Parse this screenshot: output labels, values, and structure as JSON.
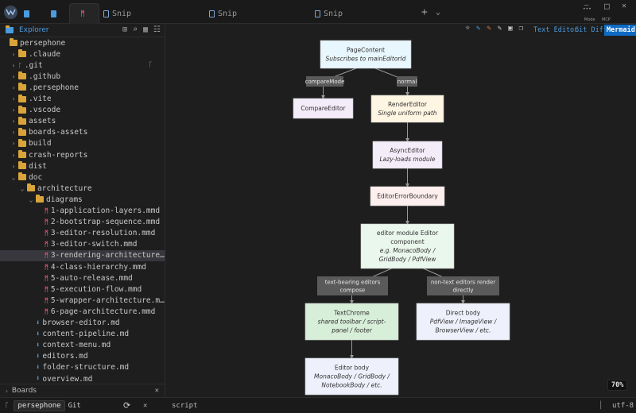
{
  "tabs": [
    {
      "label": "",
      "icon": "document-icon"
    },
    {
      "label": "",
      "icon": "document-icon"
    },
    {
      "label": "",
      "icon": "mermaid-icon"
    },
    {
      "label": "Snip",
      "icon": "document-icon"
    },
    {
      "label": "Snip",
      "icon": "document-icon"
    },
    {
      "label": "Snip",
      "icon": "document-icon"
    }
  ],
  "window": {
    "new_tab": "+",
    "dropdown": "⌄",
    "dots": "•••",
    "mode_label": "Mode",
    "mcp_label": "MCP",
    "max": "□",
    "close": "✕",
    "minimize": "—"
  },
  "sidebar": {
    "title": "Explorer",
    "git_branch": "ᚴ",
    "tree": [
      {
        "label": "persephone",
        "type": "folder",
        "depth": 0,
        "chevron": ""
      },
      {
        "label": ".claude",
        "type": "folder",
        "depth": 1,
        "chevron": "›"
      },
      {
        "label": ".git",
        "type": "git",
        "depth": 1,
        "chevron": "›"
      },
      {
        "label": ".github",
        "type": "folder",
        "depth": 1,
        "chevron": "›"
      },
      {
        "label": ".persephone",
        "type": "folder",
        "depth": 1,
        "chevron": "›"
      },
      {
        "label": ".vite",
        "type": "folder",
        "depth": 1,
        "chevron": "›"
      },
      {
        "label": ".vscode",
        "type": "folder",
        "depth": 1,
        "chevron": "›"
      },
      {
        "label": "assets",
        "type": "folder",
        "depth": 1,
        "chevron": "›"
      },
      {
        "label": "boards-assets",
        "type": "folder",
        "depth": 1,
        "chevron": "›"
      },
      {
        "label": "build",
        "type": "folder",
        "depth": 1,
        "chevron": "›"
      },
      {
        "label": "crash-reports",
        "type": "folder",
        "depth": 1,
        "chevron": "›"
      },
      {
        "label": "dist",
        "type": "folder",
        "depth": 1,
        "chevron": "›"
      },
      {
        "label": "doc",
        "type": "folder",
        "depth": 1,
        "chevron": "⌄"
      },
      {
        "label": "architecture",
        "type": "folder",
        "depth": 2,
        "chevron": "⌄"
      },
      {
        "label": "diagrams",
        "type": "folder",
        "depth": 3,
        "chevron": "⌄"
      },
      {
        "label": "1-application-layers.mmd",
        "type": "mmd",
        "depth": 4,
        "chevron": ""
      },
      {
        "label": "2-bootstrap-sequence.mmd",
        "type": "mmd",
        "depth": 4,
        "chevron": ""
      },
      {
        "label": "3-editor-resolution.mmd",
        "type": "mmd",
        "depth": 4,
        "chevron": ""
      },
      {
        "label": "3-editor-switch.mmd",
        "type": "mmd",
        "depth": 4,
        "chevron": ""
      },
      {
        "label": "3-rendering-architecture…",
        "type": "mmd",
        "depth": 4,
        "chevron": "",
        "selected": true
      },
      {
        "label": "4-class-hierarchy.mmd",
        "type": "mmd",
        "depth": 4,
        "chevron": ""
      },
      {
        "label": "5-auto-release.mmd",
        "type": "mmd",
        "depth": 4,
        "chevron": ""
      },
      {
        "label": "5-execution-flow.mmd",
        "type": "mmd",
        "depth": 4,
        "chevron": ""
      },
      {
        "label": "5-wrapper-architecture.m…",
        "type": "mmd",
        "depth": 4,
        "chevron": ""
      },
      {
        "label": "6-page-architecture.mmd",
        "type": "mmd",
        "depth": 4,
        "chevron": ""
      },
      {
        "label": "browser-editor.md",
        "type": "md",
        "depth": 3,
        "chevron": ""
      },
      {
        "label": "content-pipeline.md",
        "type": "md",
        "depth": 3,
        "chevron": ""
      },
      {
        "label": "context-menu.md",
        "type": "md",
        "depth": 3,
        "chevron": ""
      },
      {
        "label": "editors.md",
        "type": "md",
        "depth": 3,
        "chevron": ""
      },
      {
        "label": "folder-structure.md",
        "type": "md",
        "depth": 3,
        "chevron": ""
      },
      {
        "label": "overview.md",
        "type": "md",
        "depth": 3,
        "chevron": ""
      }
    ],
    "boards_label": "Boards",
    "boards_close": "✕"
  },
  "toolbar": {
    "buttons": [
      "Text Editor",
      "Git Diff",
      "Mermaid"
    ],
    "active": "Mermaid"
  },
  "diagram": {
    "nodes": [
      {
        "id": "n1",
        "title": "PageContent",
        "sub": [
          "Subscribes to mainEditorId"
        ],
        "fill": "#e8f6fd"
      },
      {
        "id": "n2",
        "title": "CompareEditor",
        "sub": [],
        "fill": "#f5ecfa"
      },
      {
        "id": "n3",
        "title": "RenderEditor",
        "sub": [
          "Single uniform path"
        ],
        "fill": "#fef5e2"
      },
      {
        "id": "n4",
        "title": "AsyncEditor",
        "sub": [
          "Lazy-loads module"
        ],
        "fill": "#f5ecfa"
      },
      {
        "id": "n5",
        "title": "EditorErrorBoundary",
        "sub": [],
        "fill": "#fdefee"
      },
      {
        "id": "n6",
        "title": "editor module Editor",
        "title2": "component",
        "sub": [
          "e.g. MonacoBody /",
          "GridBody / PdfView"
        ],
        "fill": "#eaf7ed"
      },
      {
        "id": "n7",
        "title": "TextChrome",
        "sub": [
          "shared toolbar / script-",
          "panel / footer"
        ],
        "fill": "#d7eed8"
      },
      {
        "id": "n8",
        "title": "Direct body",
        "sub": [
          "PdfView / ImageView /",
          "BrowserView / etc."
        ],
        "fill": "#eef0fb"
      },
      {
        "id": "n9",
        "title": "Editor body",
        "sub": [
          "MonacoBody / GridBody /",
          "NotebookBody / etc."
        ],
        "fill": "#eef0fb"
      }
    ],
    "edge_labels": [
      {
        "id": "e1",
        "lines": [
          "compareMode"
        ]
      },
      {
        "id": "e2",
        "lines": [
          "normal"
        ]
      },
      {
        "id": "e3",
        "lines": [
          "text-bearing editors",
          "compose"
        ]
      },
      {
        "id": "e4",
        "lines": [
          "non-text editors render",
          "directly"
        ]
      }
    ]
  },
  "zoom": "70%",
  "status": {
    "repo": "persephone",
    "git": "Git",
    "sync": "⟳",
    "close": "✕",
    "script": "script",
    "encoding": "utf-8",
    "panel_icon": "▭"
  },
  "colors": {
    "accent": "#4a9be0",
    "active_btn": "#0e6bc4",
    "mermaid": "#e0506a",
    "folder": "#d9a43a"
  }
}
